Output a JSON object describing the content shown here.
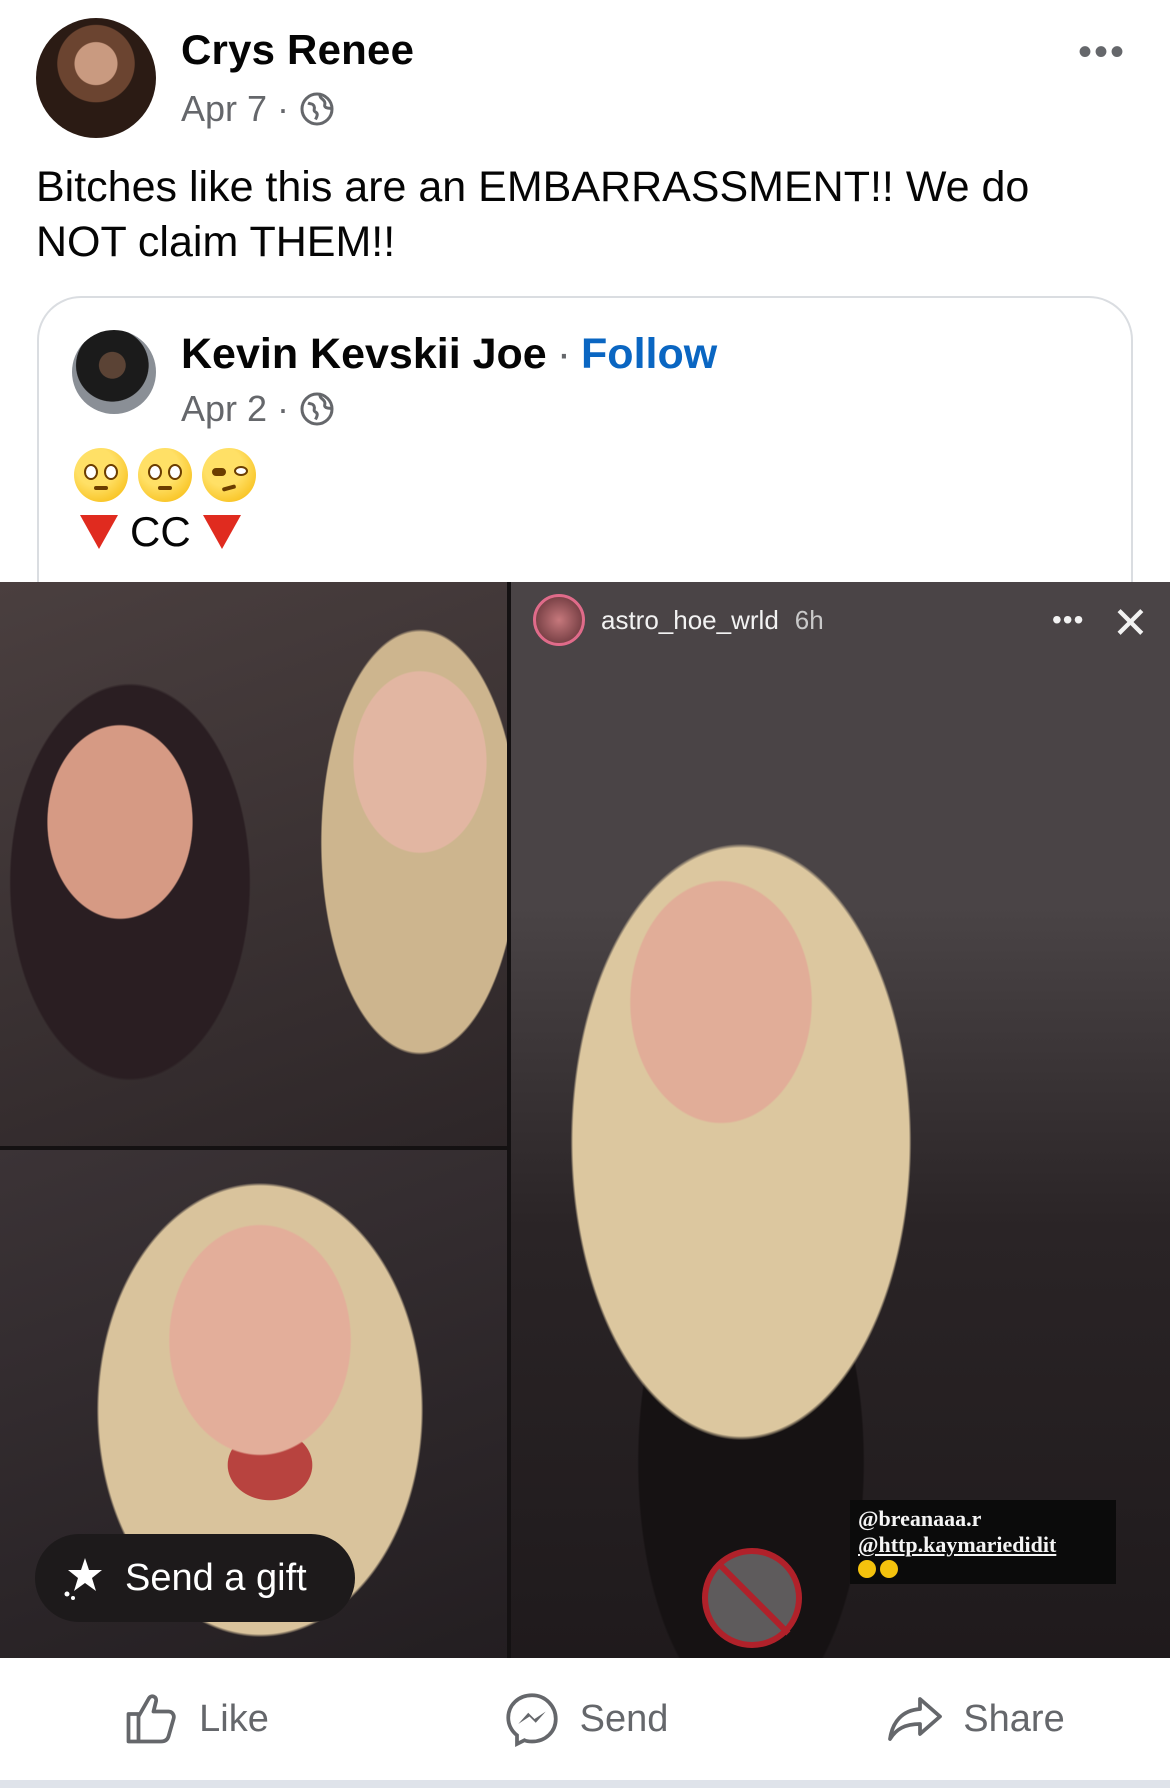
{
  "post": {
    "author": "Crys Renee",
    "date": "Apr 7",
    "separator": "·",
    "privacy_icon": "globe-icon",
    "more_label": "•••",
    "text": "Bitches like this are an EMBARRASSMENT!! We do NOT claim THEM!!"
  },
  "shared": {
    "author": "Kevin Kevskii Joe",
    "separator": "·",
    "follow_label": "Follow",
    "date": "Apr 2",
    "privacy_icon": "globe-icon",
    "emojis": [
      "flushed-face",
      "flushed-face",
      "woozy-face"
    ],
    "cc_text": "CC"
  },
  "media": {
    "story_user": "astro_hoe_wrld",
    "story_time": "6h",
    "story_more": "•••",
    "story_close": "✕",
    "tag1": "@breanaaa.r",
    "tag2": "@http.kaymariedidit",
    "gift_label": "Send a gift"
  },
  "actions": {
    "like": "Like",
    "send": "Send",
    "share": "Share"
  },
  "colors": {
    "link": "#0a66c2",
    "secondary_text": "#65676b",
    "triangle": "#e02b1f"
  }
}
